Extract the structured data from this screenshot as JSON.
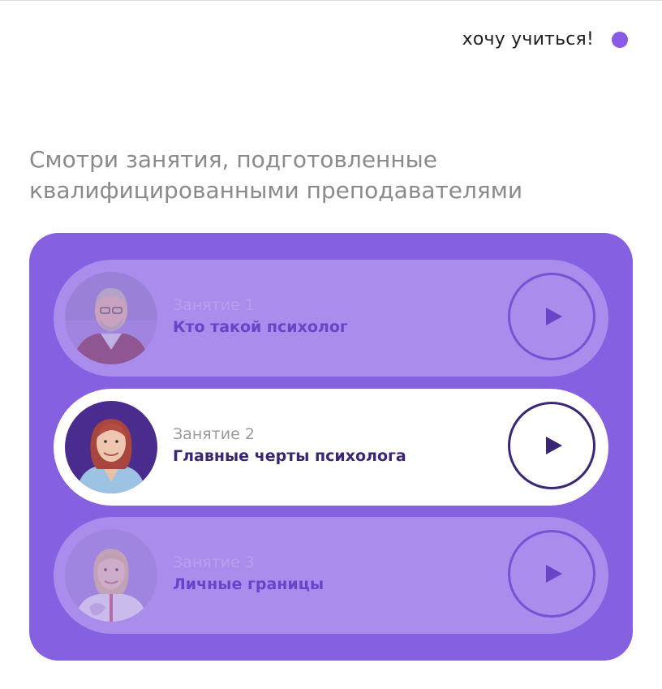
{
  "header": {
    "cta_label": "хочу учиться!",
    "accent_color": "#8a5ce4"
  },
  "intro": {
    "heading_line1": "Смотри занятия, подготовленные",
    "heading_line2": "квалифицированными преподавателями"
  },
  "lessons": [
    {
      "number_label": "Занятие 1",
      "title": "Кто такой психолог",
      "state": "inactive",
      "avatar_icon": "teacher-photo-bearded-man"
    },
    {
      "number_label": "Занятие 2",
      "title": "Главные черты психолога",
      "state": "active",
      "avatar_icon": "teacher-photo-woman-red-hair"
    },
    {
      "number_label": "Занятие 3",
      "title": "Личные границы",
      "state": "inactive",
      "avatar_icon": "teacher-photo-woman-blonde"
    }
  ],
  "colors": {
    "panel": "#8560e0",
    "card_inactive": "#a98cec",
    "card_active": "#ffffff",
    "title_dark": "#3a2576"
  }
}
